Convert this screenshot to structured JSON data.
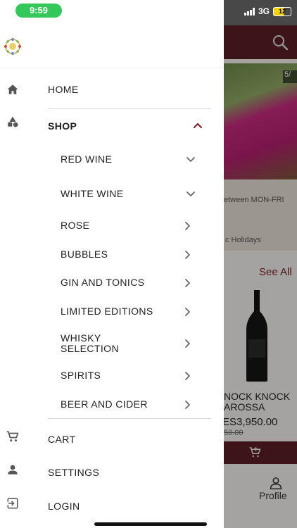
{
  "status_bar": {
    "time": "9:59",
    "network": "3G",
    "battery": "12"
  },
  "menu": {
    "home_label": "HOME",
    "shop_label": "SHOP",
    "shop_subitems": [
      {
        "label": "RED WINE",
        "chevron": "chevron-down"
      },
      {
        "label": "WHITE WINE",
        "chevron": "chevron-down"
      },
      {
        "label": "ROSE",
        "chevron": "chevron-right"
      },
      {
        "label": "BUBBLES",
        "chevron": "chevron-right"
      },
      {
        "label": "GIN AND TONICS",
        "chevron": "chevron-right"
      },
      {
        "label": "LIMITED EDITIONS",
        "chevron": "chevron-right"
      },
      {
        "label": "WHISKY SELECTION",
        "chevron": "chevron-right"
      },
      {
        "label": "SPIRITS",
        "chevron": "chevron-right"
      },
      {
        "label": "BEER AND CIDER",
        "chevron": "chevron-right"
      }
    ],
    "cart_label": "CART",
    "settings_label": "SETTINGS",
    "login_label": "LOGIN"
  },
  "background": {
    "banner_badge": "5/",
    "promo_line_1": "etween MON-FRI",
    "promo_line_2": "c Holidays",
    "see_all": "See All",
    "product_name": "NOCK KNOCK AROSSA",
    "price": "ES3,950.00",
    "old_price": "50.00",
    "profile_label": "Profile"
  },
  "colors": {
    "brand": "#5a1e23",
    "accent": "#7a1a22",
    "time_pill": "#34c759"
  }
}
